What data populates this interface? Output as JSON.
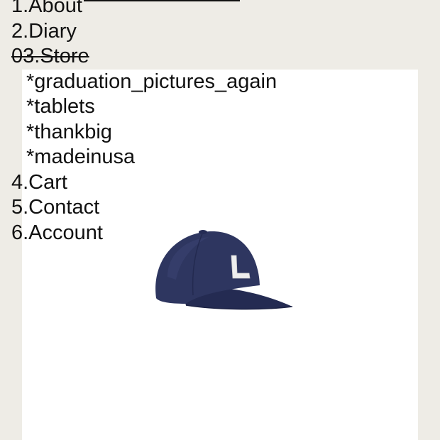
{
  "nav": {
    "items": [
      {
        "label": "1.About"
      },
      {
        "label": "2.Diary"
      },
      {
        "label": "03.Store"
      },
      {
        "label": "*graduation_pictures_again"
      },
      {
        "label": "*tablets"
      },
      {
        "label": "*thankbig"
      },
      {
        "label": "*madeinusa"
      },
      {
        "label": "4.Cart"
      },
      {
        "label": "5.Contact"
      },
      {
        "label": "6.Account"
      }
    ]
  },
  "product": {
    "image": "navy-cap-with-white-L-patch",
    "colors": {
      "cap": "#2e3660",
      "letter": "#eeeeee"
    }
  },
  "colors": {
    "page_background": "#eeece6",
    "panel_background": "#ffffff",
    "text": "#111111"
  }
}
